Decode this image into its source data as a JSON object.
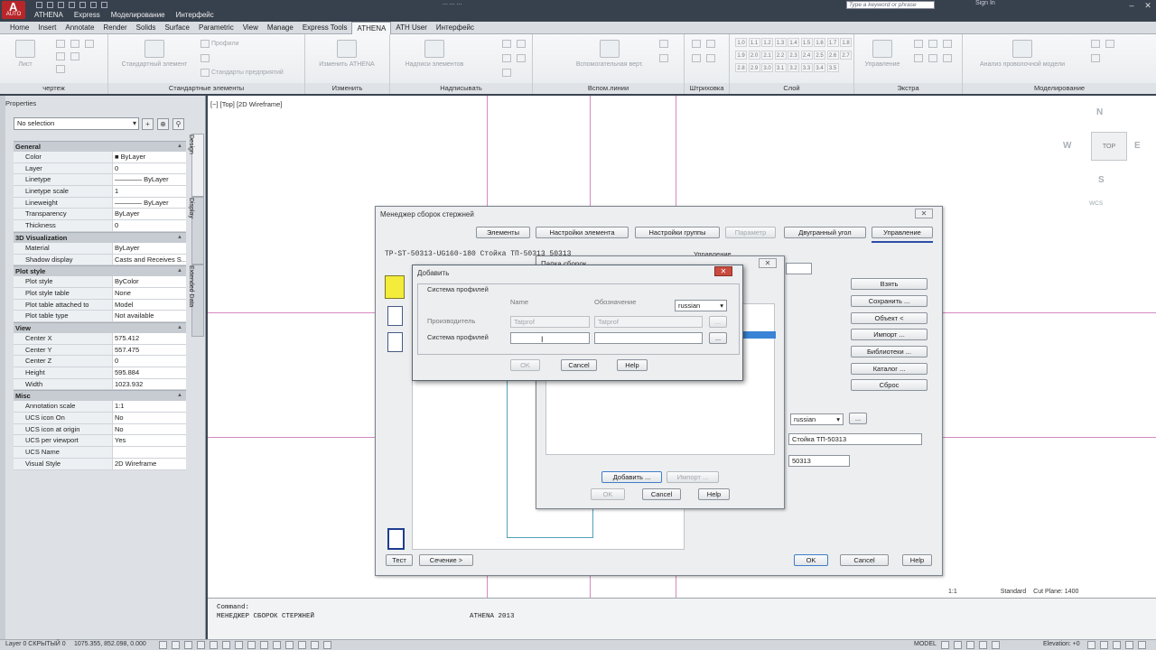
{
  "app": {
    "logo_text": "AUTO",
    "menu": [
      "ATHENA",
      "Express",
      "Моделирование",
      "Интерфейс"
    ],
    "title_text": "... ...  ...",
    "search_placeholder": "Type a keyword or phrase",
    "sign_in": "Sign In"
  },
  "ribbon": {
    "tabs": [
      "Home",
      "Insert",
      "Annotate",
      "Render",
      "Solids",
      "Surface",
      "Parametric",
      "View",
      "Manage",
      "Express Tools",
      "ATHENA",
      "ATH User",
      "Интерфейс"
    ],
    "active_tab": "ATHENA",
    "panels": {
      "chertezh": "чертеж",
      "list": "Лист",
      "standard": "Стандартные элементы",
      "std_element": "Стандартный элемент",
      "profil": "Профили",
      "std_enterprise": "Стандарты предприятий",
      "change": "Изменить",
      "change_athena": "Изменить ATHENA",
      "annotate": "Надписывать",
      "annotate_elem": "Надписи элементов",
      "aux": "Вспом.линии",
      "aux_vert": "Вспомогательная верт.",
      "hatch": "Штриховка",
      "layer": "Слой",
      "extra": "Экстра",
      "manage": "Управление",
      "modeling": "Моделирование",
      "analysis": "Анализ проволочной модели",
      "layer_grid": [
        "1.0",
        "1.1",
        "1.2",
        "1.3",
        "1.4",
        "1.5",
        "1.6",
        "1.7",
        "1.8",
        "1.9",
        "2.0",
        "2.1",
        "2.2",
        "2.3",
        "2.4",
        "2.5",
        "2.6",
        "2.7",
        "2.8",
        "2.9",
        "3.0",
        "3.1",
        "3.2",
        "3.3",
        "3.4",
        "3.5"
      ]
    }
  },
  "properties": {
    "header": "Properties",
    "selection": "No selection",
    "side_tabs": [
      "Design",
      "Display",
      "Extended Data"
    ],
    "categories": [
      {
        "name": "General",
        "rows": [
          [
            "Color",
            "■ ByLayer"
          ],
          [
            "Layer",
            "0"
          ],
          [
            "Linetype",
            "———— ByLayer"
          ],
          [
            "Linetype scale",
            "1"
          ],
          [
            "Lineweight",
            "———— ByLayer"
          ],
          [
            "Transparency",
            "ByLayer"
          ],
          [
            "Thickness",
            "0"
          ]
        ]
      },
      {
        "name": "3D Visualization",
        "rows": [
          [
            "Material",
            "ByLayer"
          ],
          [
            "Shadow display",
            "Casts and Receives S..."
          ]
        ]
      },
      {
        "name": "Plot style",
        "rows": [
          [
            "Plot style",
            "ByColor"
          ],
          [
            "Plot style table",
            "None"
          ],
          [
            "Plot table attached to",
            "Model"
          ],
          [
            "Plot table type",
            "Not available"
          ]
        ]
      },
      {
        "name": "View",
        "rows": [
          [
            "Center X",
            "575.412"
          ],
          [
            "Center Y",
            "557.475"
          ],
          [
            "Center Z",
            "0"
          ],
          [
            "Height",
            "595.884"
          ],
          [
            "Width",
            "1023.932"
          ]
        ]
      },
      {
        "name": "Misc",
        "rows": [
          [
            "Annotation scale",
            "1:1"
          ],
          [
            "UCS icon On",
            "No"
          ],
          [
            "UCS icon at origin",
            "No"
          ],
          [
            "UCS per viewport",
            "Yes"
          ],
          [
            "UCS Name",
            ""
          ],
          [
            "Visual Style",
            "2D Wireframe"
          ]
        ]
      }
    ]
  },
  "viewport": {
    "label": "[−] [Top] [2D Wireframe]",
    "compass": {
      "n": "N",
      "s": "S",
      "w": "W",
      "e": "E",
      "top": "TOP"
    },
    "wcs": "WCS"
  },
  "manager_dialog": {
    "title": "Менеджер сборок стержней",
    "tabs": [
      "Элементы",
      "Настройки элемента",
      "Настройки группы",
      "Параметр",
      "Двугранный угол",
      "Управление"
    ],
    "heading": "TP-ST-50313-UG160-180 Стойка ТП-50313 50313",
    "upravlenie_label": "Управление",
    "side_buttons": [
      "Взять",
      "Сохранить ...",
      "Объект <",
      "Импорт ...",
      "Библиотеки ...",
      "Каталог ...",
      "Сброс"
    ],
    "lang_value": "russian",
    "lang_btn": "...",
    "name_field": "Стойка ТП-50313",
    "code_field": "50313",
    "bottom_left": [
      "Тест",
      "Сечение >"
    ],
    "bottom_right": [
      "OK",
      "Cancel",
      "Help"
    ]
  },
  "folder_dialog": {
    "title": "Папка сборок",
    "buttons_top": [
      "Добавить ...",
      "Импорт ..."
    ],
    "buttons_bottom": [
      "OK",
      "Cancel",
      "Help"
    ]
  },
  "add_dialog": {
    "title": "Добавить",
    "group_label": "Система профилей",
    "col_name": "Name",
    "col_oboz": "Обозначение",
    "lang": "russian",
    "row1_label": "Производитель",
    "row1_name": "Tatprof",
    "row1_oboz": "Tatprof",
    "row2_label": "Система профилей",
    "row2_name": "",
    "row2_oboz": "",
    "browse": "...",
    "ok": "OK",
    "cancel": "Cancel",
    "help": "Help"
  },
  "command": {
    "prompt": "Command:",
    "last": "МЕНЕДЖЕР СБОРОК СТЕРЖНЕЙ",
    "info": "ATHENA  2013"
  },
  "canvas_status": {
    "scale": "1:1",
    "style": "Standard",
    "cut_plane": "Cut Plane: 1400"
  },
  "status": {
    "left": "Layer 0 СКРЫТЫЙ 0",
    "coords": "1075.355, 852.098, 0.000",
    "model": "MODEL",
    "elevation": "Elevation: +0"
  }
}
